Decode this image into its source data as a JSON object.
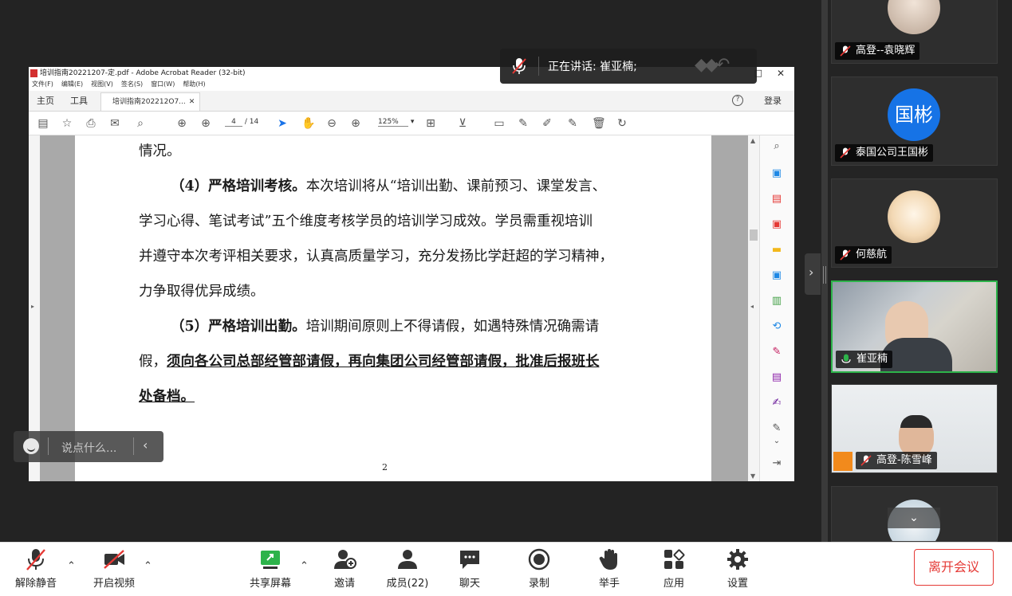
{
  "acrobat": {
    "window_title": "培训指南20221207-定.pdf - Adobe Acrobat Reader (32-bit)",
    "menu": [
      "文件(F)",
      "编辑(E)",
      "视图(V)",
      "签名(S)",
      "窗口(W)",
      "帮助(H)"
    ],
    "tab_home": "主页",
    "tab_tools": "工具",
    "tab_doc": "培训指南202212O7...",
    "login": "登录",
    "page_current": "4",
    "page_total": "/ 14",
    "zoom": "125%",
    "page_number_footer": "2"
  },
  "document": {
    "line0": "情况。",
    "line1_bold": "（4）严格培训考核。",
    "line1_rest": "本次培训将从“培训出勤、课前预习、课堂发言、",
    "line2": "学习心得、笔试考试”五个维度考核学员的培训学习成效。学员需重视培训",
    "line3": "并遵守本次考评相关要求，认真高质量学习，充分发扬比学赶超的学习精神，",
    "line4": "力争取得优异成绩。",
    "line5_bold": "（5）严格培训出勤。",
    "line5_rest": "培训期间原则上不得请假，如遇特殊情况确需请",
    "line6_plain": "假，",
    "line6_ul": "须向各公司总部经管部请假，再向集团公司经管部请假，批准后报班长",
    "line7_ul": "处备档。"
  },
  "speaking": {
    "text": "正在讲话: 崔亚楠;"
  },
  "chat": {
    "placeholder": "说点什么..."
  },
  "participants": [
    {
      "name": "高登--袁晓辉",
      "muted": true
    },
    {
      "name": "泰国公司王国彬",
      "avatar_text": "国彬",
      "muted": true
    },
    {
      "name": "何慈航",
      "muted": true
    },
    {
      "name": "崔亚楠",
      "muted": false,
      "speaking": true
    },
    {
      "name": "高登-陈雪峰",
      "muted": true
    }
  ],
  "toolbar": {
    "unmute": "解除静音",
    "start_video": "开启视频",
    "share_screen": "共享屏幕",
    "invite": "邀请",
    "members": "成员(22)",
    "chat": "聊天",
    "record": "录制",
    "raise_hand": "举手",
    "apps": "应用",
    "settings": "设置",
    "leave": "离开会议"
  },
  "colors": {
    "accent_green": "#2db34a",
    "avatar_blue": "#1673e6",
    "leave_red": "#e53935",
    "muted_red": "#e53935"
  }
}
